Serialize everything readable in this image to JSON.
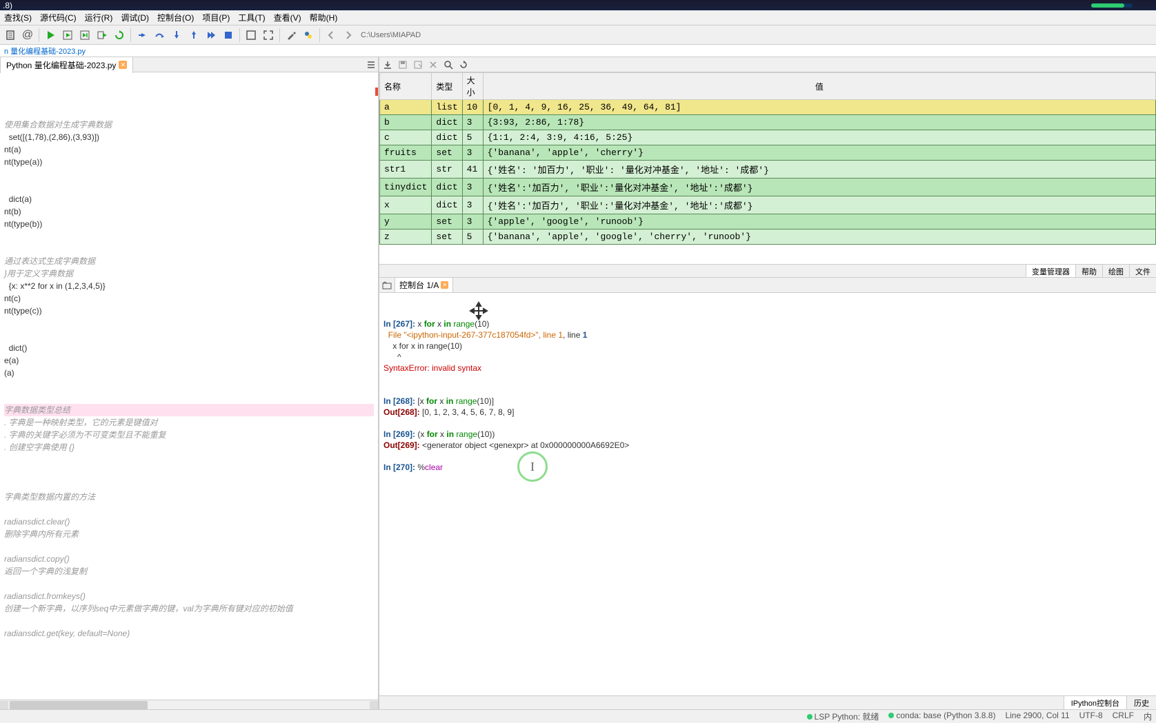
{
  "title": ".8)",
  "menus": [
    "查找(S)",
    "源代码(C)",
    "运行(R)",
    "调试(D)",
    "控制台(O)",
    "项目(P)",
    "工具(T)",
    "查看(V)",
    "帮助(H)"
  ],
  "toolbar_path": "C:\\Users\\MIAPAD",
  "file_tab": "n 量化编程基础-2023.py",
  "editor_tab": "Python 量化编程基础-2023.py",
  "code": [
    {
      "cls": "code-comment",
      "t": "使用集合数据对生成字典数据"
    },
    {
      "cls": "",
      "t": "  set([(1,78),(2,86),(3,93)])"
    },
    {
      "cls": "",
      "t": "nt(a)"
    },
    {
      "cls": "",
      "t": "nt(type(a))"
    },
    {
      "cls": "",
      "t": ""
    },
    {
      "cls": "",
      "t": ""
    },
    {
      "cls": "",
      "t": "  dict(a)"
    },
    {
      "cls": "",
      "t": "nt(b)"
    },
    {
      "cls": "",
      "t": "nt(type(b))"
    },
    {
      "cls": "",
      "t": ""
    },
    {
      "cls": "",
      "t": ""
    },
    {
      "cls": "code-comment",
      "t": "通过表达式生成字典数据"
    },
    {
      "cls": "code-comment",
      "t": "}用于定义字典数据"
    },
    {
      "cls": "",
      "t": "  {x: x**2 for x in (1,2,3,4,5)}"
    },
    {
      "cls": "",
      "t": "nt(c)"
    },
    {
      "cls": "",
      "t": "nt(type(c))"
    },
    {
      "cls": "",
      "t": ""
    },
    {
      "cls": "",
      "t": ""
    },
    {
      "cls": "",
      "t": "  dict()"
    },
    {
      "cls": "",
      "t": "e(a)"
    },
    {
      "cls": "",
      "t": "(a)"
    },
    {
      "cls": "",
      "t": ""
    },
    {
      "cls": "",
      "t": ""
    },
    {
      "cls": "code-hl code-comment",
      "t": "字典数据类型总结"
    },
    {
      "cls": "code-comment",
      "t": ". 字典是一种映射类型，它的元素是键值对"
    },
    {
      "cls": "code-comment",
      "t": ". 字典的关键字必须为不可变类型且不能重复"
    },
    {
      "cls": "code-comment",
      "t": ". 创建空字典使用 {}"
    },
    {
      "cls": "",
      "t": ""
    },
    {
      "cls": "",
      "t": ""
    },
    {
      "cls": "",
      "t": ""
    },
    {
      "cls": "code-comment",
      "t": "字典类型数据内置的方法"
    },
    {
      "cls": "",
      "t": ""
    },
    {
      "cls": "code-comment",
      "t": "radiansdict.clear()"
    },
    {
      "cls": "code-comment",
      "t": "删除字典内所有元素"
    },
    {
      "cls": "",
      "t": ""
    },
    {
      "cls": "code-comment",
      "t": "radiansdict.copy()"
    },
    {
      "cls": "code-comment",
      "t": "返回一个字典的浅复制"
    },
    {
      "cls": "",
      "t": ""
    },
    {
      "cls": "code-comment",
      "t": "radiansdict.fromkeys()"
    },
    {
      "cls": "code-comment",
      "t": "创建一个新字典，以序列seq中元素做字典的键，val为字典所有键对应的初始值"
    },
    {
      "cls": "",
      "t": ""
    },
    {
      "cls": "code-comment",
      "t": "radiansdict.get(key, default=None)"
    }
  ],
  "var_headers": {
    "name": "名称",
    "type": "类型",
    "size": "大小",
    "value": "值"
  },
  "variables": [
    {
      "n": "a",
      "t": "list",
      "s": "10",
      "v": "[0, 1, 4, 9, 16, 25, 36, 49, 64, 81]",
      "hl": true
    },
    {
      "n": "b",
      "t": "dict",
      "s": "3",
      "v": "{3:93, 2:86, 1:78}"
    },
    {
      "n": "c",
      "t": "dict",
      "s": "5",
      "v": "{1:1, 2:4, 3:9, 4:16, 5:25}"
    },
    {
      "n": "fruits",
      "t": "set",
      "s": "3",
      "v": "{'banana', 'apple', 'cherry'}"
    },
    {
      "n": "str1",
      "t": "str",
      "s": "41",
      "v": "{'姓名': '加百力', '职业': '量化对冲基金', '地址': '成都'}"
    },
    {
      "n": "tinydict",
      "t": "dict",
      "s": "3",
      "v": "{'姓名':'加百力', '职业':'量化对冲基金', '地址':'成都'}"
    },
    {
      "n": "x",
      "t": "dict",
      "s": "3",
      "v": "{'姓名':'加百力', '职业':'量化对冲基金', '地址':'成都'}"
    },
    {
      "n": "y",
      "t": "set",
      "s": "3",
      "v": "{'apple', 'google', 'runoob'}"
    },
    {
      "n": "z",
      "t": "set",
      "s": "5",
      "v": "{'banana', 'apple', 'google', 'cherry', 'runoob'}"
    }
  ],
  "pane_tabs": [
    "变量管理器",
    "帮助",
    "绘图",
    "文件"
  ],
  "console_tab": "控制台 1/A",
  "console_bottom_tabs": [
    "IPython控制台",
    "历史"
  ],
  "console": {
    "in267": "In [267]:",
    "in267_code": " x for x in range(10)",
    "file_line": "  File \"<ipython-input-267-377c187054fd>\", line 1",
    "echo": "    x for x in range(10)",
    "caret": "      ^",
    "err": "SyntaxError: invalid syntax",
    "in268": "In [268]:",
    "in268_code": " [x for x in range(10)]",
    "out268": "Out[268]:",
    "out268_val": " [0, 1, 2, 3, 4, 5, 6, 7, 8, 9]",
    "in269": "In [269]:",
    "in269_code": " (x for x in range(10))",
    "out269": "Out[269]:",
    "out269_val": " <generator object <genexpr> at 0x000000000A6692E0>",
    "in270": "In [270]:",
    "in270_code": " %clear"
  },
  "status": {
    "lsp": "LSP Python: 就绪",
    "conda": "conda: base (Python 3.8.8)",
    "line": "Line 2900, Col 11",
    "enc": "UTF-8",
    "eol": "CRLF",
    "mem": "内"
  }
}
